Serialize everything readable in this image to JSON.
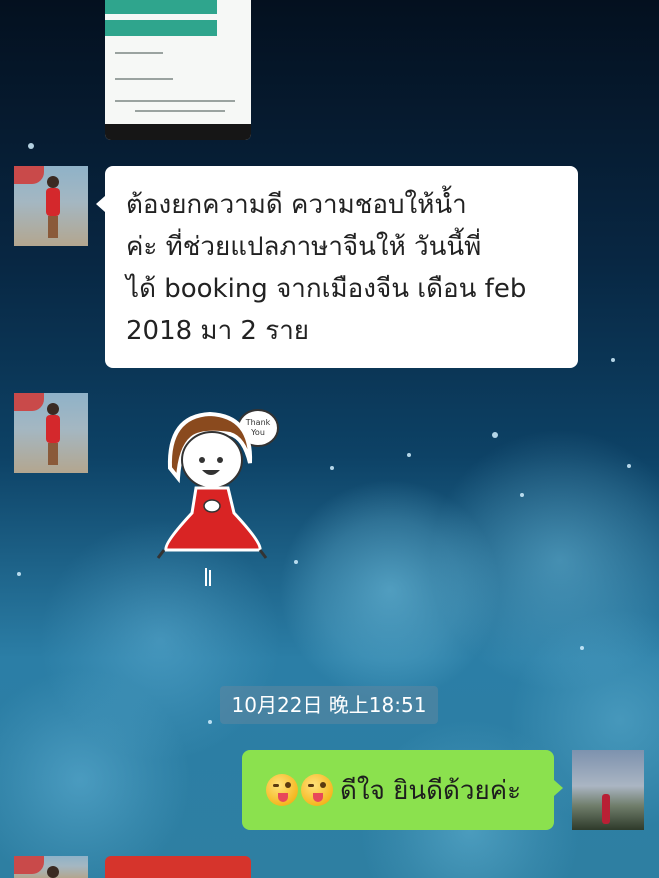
{
  "chat": {
    "incoming_message": {
      "lines": [
        "ต้องยกความดี ความชอบให้น้ำ",
        "ค่ะ ที่ช่วยแปลภาษาจีนให้ วันนี้พี่",
        "ได้ booking จากเมืองจีน เดือน feb",
        "2018 มา 2 ราย"
      ]
    },
    "sticker": {
      "icon": "thank-you-sticker-icon",
      "label": "Thank You"
    },
    "timestamp": "10月22日 晚上18:51",
    "outgoing_message": {
      "emoji_icon": "winking-tongue-face-icon",
      "emoji_count": 2,
      "text": "ดีใจ ยินดีด้วยค่ะ",
      "color": "#8be14e"
    }
  },
  "colors": {
    "incoming_bubble": "#ffffff",
    "outgoing_bubble": "#8be14e",
    "timestamp_bg": "#5f87a0"
  }
}
